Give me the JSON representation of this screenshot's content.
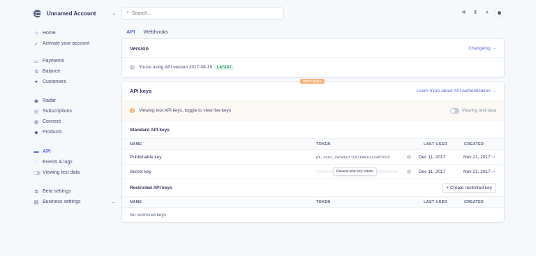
{
  "account": {
    "name": "Unnamed Account"
  },
  "search": {
    "placeholder": "Search..."
  },
  "sidebar": {
    "group1": [
      "Home",
      "Activate your account"
    ],
    "group2": [
      "Payments",
      "Balance",
      "Customers"
    ],
    "group3": [
      "Radar",
      "Subscriptions",
      "Connect",
      "Products"
    ],
    "group4": [
      "API",
      "Events & logs",
      "Viewing test data"
    ],
    "group5": [
      "Beta settings",
      "Business settings"
    ]
  },
  "tabs": [
    "API",
    "Webhooks"
  ],
  "version_card": {
    "title": "Version",
    "link": "Changelog →",
    "info": "You're using API version 2017-08-15",
    "badge": "LATEST"
  },
  "keys_card": {
    "tag": "TEST DATA",
    "title": "API keys",
    "link": "Learn more about API authentication →",
    "warning": "Viewing test API keys, toggle to view live keys",
    "toggle_label": "Viewing test data",
    "standard": {
      "title": "Standard API keys",
      "headers": {
        "name": "NAME",
        "token": "TOKEN",
        "last_used": "LAST USED",
        "created": "CREATED"
      },
      "rows": [
        {
          "name": "Publishable key",
          "token": "pk_test_zwrWUut1CmIPmEG1a3AMTOVO",
          "last_used": "Dec 11, 2017",
          "created": "Nov 21, 2017"
        },
        {
          "name": "Secret key",
          "token": "Reveal test key token",
          "last_used": "Dec 11, 2017",
          "created": "Nov 21, 2017"
        }
      ]
    },
    "restricted": {
      "title": "Restricted API keys",
      "button": "+ Create restricted key",
      "headers": {
        "name": "NAME",
        "token": "TOKEN",
        "last_used": "LAST USED",
        "created": "CREATED"
      },
      "empty": "No restricted keys"
    }
  },
  "colors": {
    "accent": "#5469d4",
    "warning": "#f5b46b",
    "test_tag": "#f7b27a"
  }
}
